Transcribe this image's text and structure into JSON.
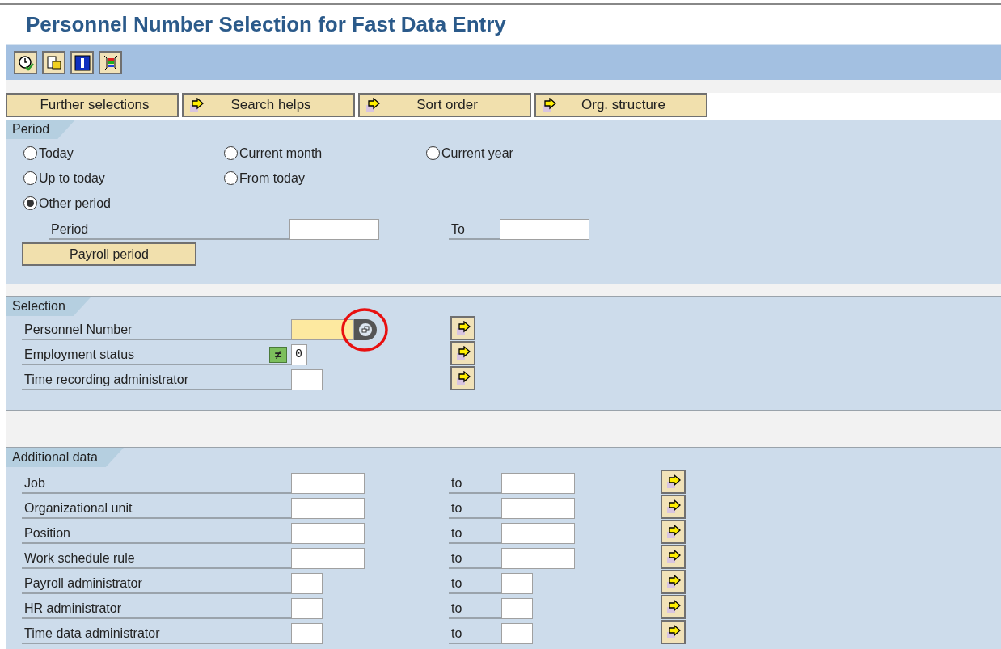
{
  "title": "Personnel Number Selection for Fast Data Entry",
  "toolbar": [
    {
      "kind": "clock"
    },
    {
      "kind": "copy"
    },
    {
      "kind": "info"
    },
    {
      "kind": "layout"
    }
  ],
  "top_buttons": [
    {
      "label": "Further selections",
      "arrow": false
    },
    {
      "label": "Search helps",
      "arrow": true
    },
    {
      "label": "Sort order",
      "arrow": true
    },
    {
      "label": "Org. structure",
      "arrow": true
    }
  ],
  "period": {
    "tab": "Period",
    "options": [
      {
        "label": "Today",
        "selected": false
      },
      {
        "label": "Current month",
        "selected": false
      },
      {
        "label": "Current year",
        "selected": false
      },
      {
        "label": "Up to today",
        "selected": false
      },
      {
        "label": "From today",
        "selected": false
      },
      {
        "label": "Other period",
        "selected": true
      }
    ],
    "from_label": "Period",
    "to_label": "To",
    "button": "Payroll period"
  },
  "selection": {
    "tab": "Selection",
    "rows": [
      {
        "label": "Personnel Number",
        "kind": "required",
        "highlighted": true
      },
      {
        "label": "Employment status",
        "kind": "option",
        "operator": "≠",
        "value": "0"
      },
      {
        "label": "Time recording administrator",
        "kind": "small"
      }
    ]
  },
  "additional": {
    "tab": "Additional data",
    "rows": [
      {
        "label": "Job",
        "kind": "wide",
        "to": "to"
      },
      {
        "label": "Organizational unit",
        "kind": "wide",
        "to": "to"
      },
      {
        "label": "Position",
        "kind": "wide",
        "to": "to"
      },
      {
        "label": "Work schedule rule",
        "kind": "wide",
        "to": "to"
      },
      {
        "label": "Payroll administrator",
        "kind": "small",
        "to": "to"
      },
      {
        "label": "HR administrator",
        "kind": "small",
        "to": "to"
      },
      {
        "label": "Time data administrator",
        "kind": "small",
        "to": "to"
      }
    ]
  }
}
